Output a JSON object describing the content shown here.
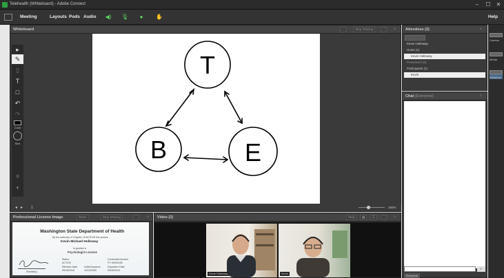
{
  "window": {
    "title": "Telehealth (Whiteboard) - Adobe Connect",
    "minimize": "–",
    "maximize": "☐",
    "close": "✕"
  },
  "menubar": {
    "items": [
      "Meeting",
      "Layouts",
      "Pods",
      "Audio"
    ],
    "help": "Help"
  },
  "whiteboard": {
    "title": "Whiteboard",
    "stop_sharing": "Stop Sharing",
    "zoom": "100%",
    "page": "1",
    "tool_labels": {
      "color": "Color",
      "size": "Size"
    },
    "drawing": {
      "top": "T",
      "left": "B",
      "right": "E"
    }
  },
  "attendees": {
    "title": "Attendees",
    "count": "(2)",
    "me": "Kevin Holloway",
    "groups": [
      {
        "name": "Hosts (1)",
        "members": [
          "Kevin Holloway"
        ]
      },
      {
        "name": "Presenters (0)",
        "members": []
      },
      {
        "name": "Participants (1)",
        "members": [
          "Kevin"
        ]
      }
    ]
  },
  "chat": {
    "title": "Chat",
    "scope": "(Everyone)",
    "tab": "Everyone"
  },
  "license_pod": {
    "title": "Professional License Image",
    "share": "Share",
    "stop_sharing": "Stop Sharing",
    "card": {
      "heading": "Washington State Department of Health",
      "authority": "By the authority of Chapter 18.83 RCW this person",
      "name": "Kevin Michael Holloway",
      "granted": "is granted a",
      "license": "Psychologist License",
      "status_label": "Status",
      "status": "ACTIVE",
      "credential_label": "Credential Number",
      "credential": "PY 60091156",
      "effective_label": "Effective Date",
      "effective": "09/18/2018",
      "initial_label": "Initial Issuance",
      "initial": "10/13/2009",
      "expiration_label": "Expiration Date",
      "expiration": "09/28/2019",
      "secretary": "Secretary"
    }
  },
  "video_pod": {
    "title": "Video",
    "count": "(2)",
    "stop": "Stop",
    "feeds": [
      {
        "name": "Kevin Holloway"
      },
      {
        "name": "Kevin"
      }
    ]
  },
  "right_strip": {
    "items": [
      "Commo",
      "Media",
      "Whiteboa"
    ]
  },
  "colors": {
    "chrome_dark": "#2b2b2b",
    "pod_bg": "#3a3a3a",
    "active_green": "#5fd35f"
  }
}
